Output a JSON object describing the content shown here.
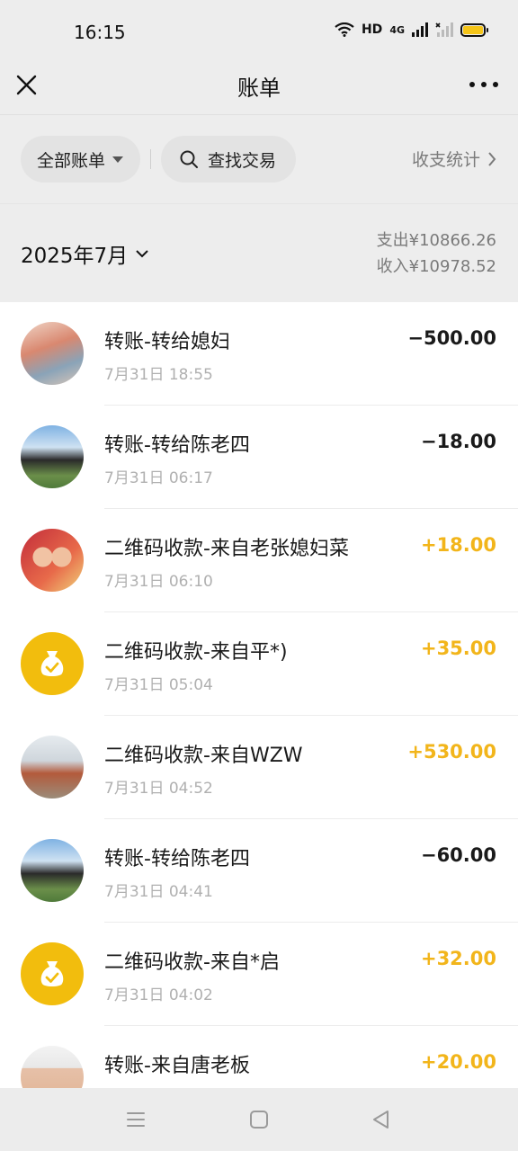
{
  "status_bar": {
    "time": "16:15",
    "network_label": "HD",
    "signal_label": "4G"
  },
  "nav": {
    "title": "账单"
  },
  "filters": {
    "all_label": "全部账单",
    "search_label": "查找交易",
    "stats_label": "收支统计"
  },
  "month": {
    "label": "2025年7月",
    "expense": "支出¥10866.26",
    "income": "收入¥10978.52"
  },
  "transactions": [
    {
      "title": "转账-转给媳妇",
      "time": "7月31日 18:55",
      "amount": "−500.00",
      "type": "expense",
      "avatar": "photo"
    },
    {
      "title": "转账-转给陈老四",
      "time": "7月31日 06:17",
      "amount": "−18.00",
      "type": "expense",
      "avatar": "photo"
    },
    {
      "title": "二维码收款-来自老张媳妇菜",
      "time": "7月31日 06:10",
      "amount": "+18.00",
      "type": "income",
      "avatar": "photo"
    },
    {
      "title": "二维码收款-来自平*)",
      "time": "7月31日 05:04",
      "amount": "+35.00",
      "type": "income",
      "avatar": "money-bag-icon"
    },
    {
      "title": "二维码收款-来自WZW",
      "time": "7月31日 04:52",
      "amount": "+530.00",
      "type": "income",
      "avatar": "photo"
    },
    {
      "title": "转账-转给陈老四",
      "time": "7月31日 04:41",
      "amount": "−60.00",
      "type": "expense",
      "avatar": "photo"
    },
    {
      "title": "二维码收款-来自*启",
      "time": "7月31日 04:02",
      "amount": "+32.00",
      "type": "income",
      "avatar": "money-bag-icon"
    },
    {
      "title": "转账-来自唐老板",
      "time": "",
      "amount": "+20.00",
      "type": "income",
      "avatar": "photo"
    }
  ],
  "colors": {
    "income": "#f2b51b",
    "background": "#ededed",
    "list_bg": "#ffffff",
    "money_bag_bg": "#f2bd0d"
  }
}
